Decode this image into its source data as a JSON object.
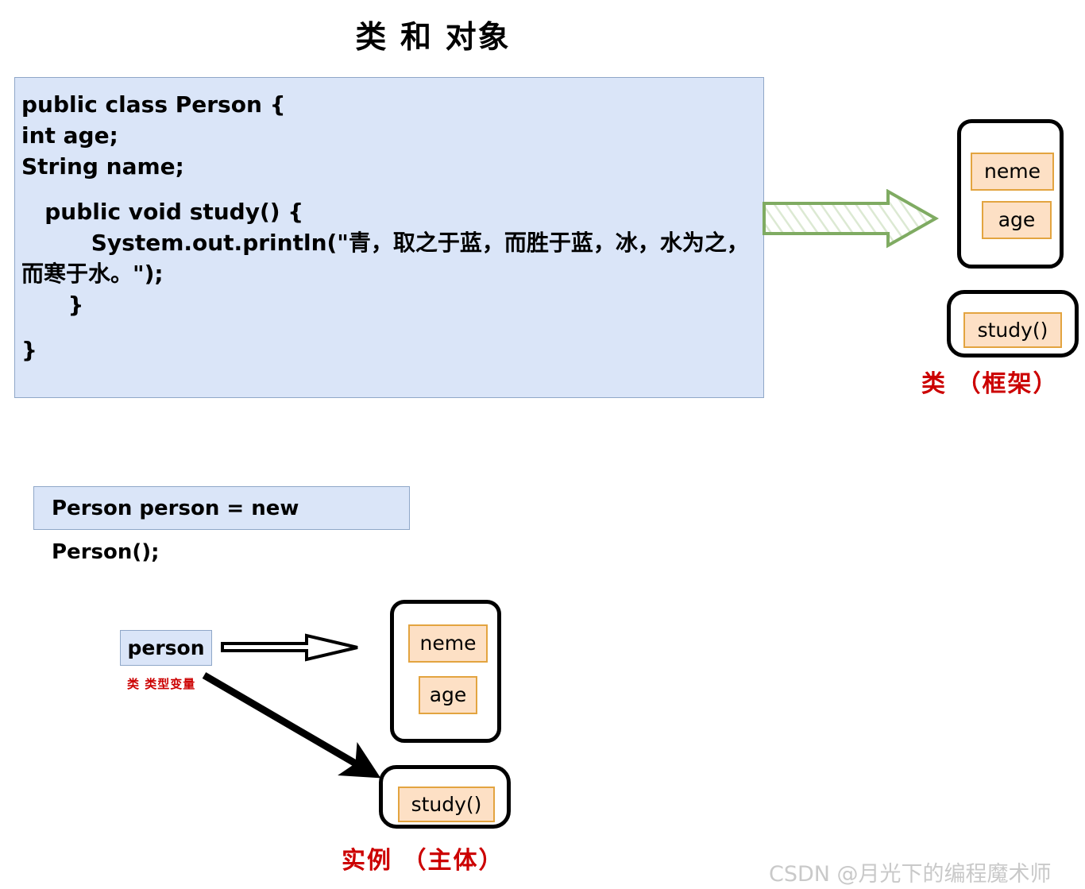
{
  "title": "类 和 对象",
  "class_code": {
    "lines": [
      "public class Person {",
      "int age;",
      "String name;",
      "",
      "   public void study() {",
      "         System.out.println(\"青，取之于蓝，而胜于蓝，冰，水为之，而寒于水。\");",
      "      }",
      "",
      "}"
    ]
  },
  "instance_code": {
    "text": "Person person = new Person();"
  },
  "class_diagram": {
    "field_name": "neme",
    "field_age": "age",
    "method_study": "study()",
    "caption": "类   （框架）",
    "caption_color": "#cc0000"
  },
  "instance_diagram": {
    "variable_label": "person",
    "variable_note": "类 类型变量",
    "field_name": "neme",
    "field_age": "age",
    "method_study": "study()",
    "caption": "实例   （主体）",
    "caption_color": "#cc0000"
  },
  "arrows": {
    "green_block_arrow_color": "#7fab62",
    "thin_outline_arrow_color": "#000000",
    "thick_arrow_color": "#000000"
  },
  "colors": {
    "code_background": "#dae5f8",
    "code_border": "#8fa7c8",
    "field_background": "#fde0c5",
    "field_border": "#e3a440",
    "sketch_border": "#000000",
    "accent_red": "#cc0000",
    "watermark": "#c9c9c9"
  },
  "watermark": "CSDN @月光下的编程魔术师"
}
